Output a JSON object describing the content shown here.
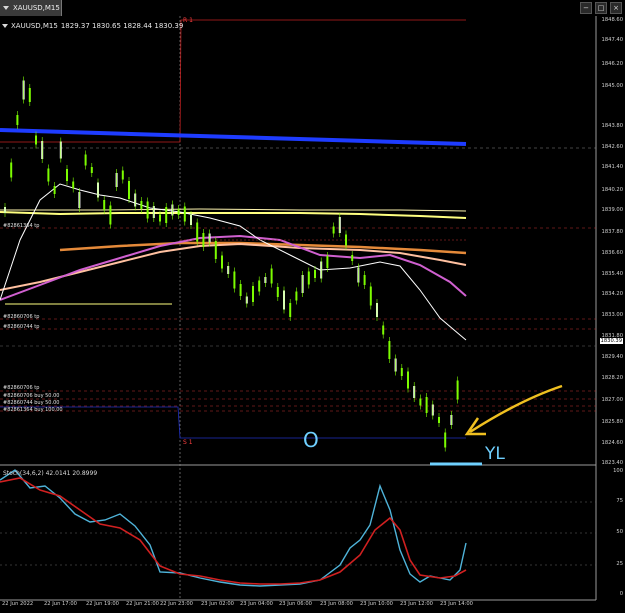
{
  "window": {
    "symbol_title": "XAUUSD,M15",
    "ohlc": "1829.37 1830.65 1828.44 1830.39",
    "buttons": [
      "−",
      "□",
      "×"
    ]
  },
  "stochastic": {
    "title": "Stoch(34,6,2) 42.0141 20.8999",
    "levels": [
      "100",
      "75",
      "50",
      "25",
      "0"
    ]
  },
  "price_axis": [
    "1848.60",
    "1847.40",
    "1846.20",
    "1845.00",
    "1843.80",
    "1842.60",
    "1841.40",
    "1840.20",
    "1839.00",
    "1837.80",
    "1836.60",
    "1835.40",
    "1834.20",
    "1833.00",
    "1831.80",
    "1829.40",
    "1828.20",
    "1827.00",
    "1825.80",
    "1824.60",
    "1823.40"
  ],
  "current_price": "1830.39",
  "time_axis": [
    "22 Jun 2022",
    "22 Jun 17:00",
    "22 Jun 19:00",
    "22 Jun 21:00",
    "22 Jun 23:00",
    "23 Jun 02:00",
    "23 Jun 04:00",
    "23 Jun 06:00",
    "23 Jun 08:00",
    "23 Jun 10:00",
    "23 Jun 12:00",
    "23 Jun 14:00"
  ],
  "orders": {
    "tp1": "#82861364 tp",
    "tp2": "#82860706 tp",
    "tp3": "#82860744 tp",
    "o1": "#82860706 tp",
    "o2": "#82860706 buy 50.00",
    "o3": "#82860744 buy 50.00",
    "o4": "#82861364 buy 100.00"
  },
  "markers": {
    "top": "R 1",
    "bottom": "S 1"
  },
  "annotations": {
    "circle_letter": "O",
    "yl": "YL"
  },
  "colors": {
    "background": "#000000",
    "candle": "#7CFC00",
    "blue_line": "#1e3cff",
    "yellow_line": "#ffff80",
    "orange_line": "#e58a3a",
    "pink_line": "#ff9ab0",
    "magenta_line": "#d060d0",
    "white_line": "#ffffff",
    "stoch_main": "#4fb3d9",
    "stoch_signal": "#d02020",
    "arrow": "#f0c020"
  }
}
